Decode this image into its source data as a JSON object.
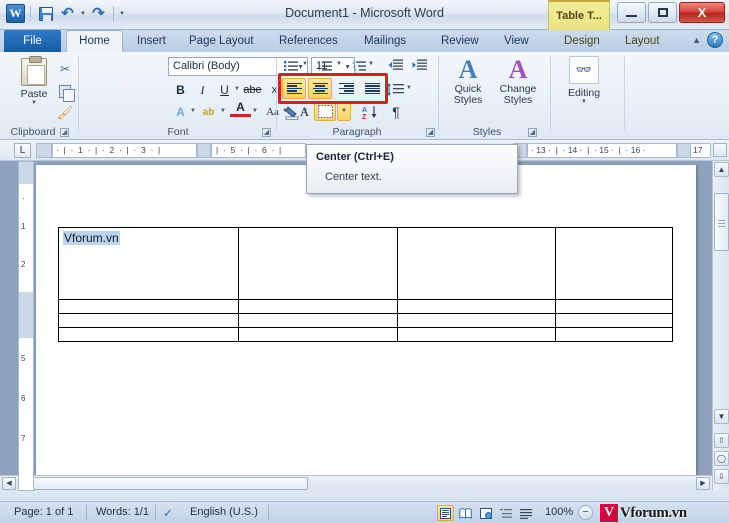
{
  "titlebar": {
    "app_icon": "word-logo-icon",
    "quick_access": [
      {
        "name": "save-icon",
        "label": "Save"
      },
      {
        "name": "undo-icon",
        "label": "Undo"
      },
      {
        "name": "redo-icon",
        "label": "Redo"
      },
      {
        "name": "customize-qat-icon",
        "label": "Customize Quick Access Toolbar"
      }
    ],
    "title": "Document1  -  Microsoft Word",
    "contextual_tab": "Table T...",
    "window_buttons": {
      "minimize": "Minimize",
      "maximize": "Maximize",
      "close": "X"
    }
  },
  "tabs": [
    {
      "label": "File",
      "state": "file"
    },
    {
      "label": "Home",
      "state": "active"
    },
    {
      "label": "Insert",
      "state": "normal"
    },
    {
      "label": "Page Layout",
      "state": "normal"
    },
    {
      "label": "References",
      "state": "normal"
    },
    {
      "label": "Mailings",
      "state": "normal"
    },
    {
      "label": "Review",
      "state": "normal"
    },
    {
      "label": "View",
      "state": "normal"
    },
    {
      "label": "Design",
      "state": "contextual"
    },
    {
      "label": "Layout",
      "state": "contextual"
    }
  ],
  "help": {
    "collapse_icon": "chevron-up-icon",
    "help_icon": "question-mark-icon",
    "help_label": "?"
  },
  "ribbon": {
    "clipboard": {
      "label": "Clipboard",
      "paste": "Paste",
      "cut": "Cut",
      "copy": "Copy",
      "format_painter": "Format Painter"
    },
    "font": {
      "label": "Font",
      "font_name": "Calibri (Body)",
      "font_size": "11",
      "bold": "B",
      "italic": "I",
      "underline": "U",
      "strikethrough": "abe",
      "subscript": "x₂",
      "superscript": "x²",
      "clear_formatting": "Clear Formatting",
      "text_effects": "A",
      "highlight": "ab",
      "font_color": "A",
      "change_case": "Aa",
      "grow_font": "A",
      "shrink_font": "A"
    },
    "paragraph": {
      "label": "Paragraph",
      "bullets": "Bullets",
      "numbering": "Numbering",
      "multilevel": "Multilevel List",
      "decrease_indent": "Decrease Indent",
      "increase_indent": "Increase Indent",
      "sort": "Sort",
      "show_marks": "¶",
      "align_left": "Align Text Left",
      "align_center": "Center",
      "align_right": "Align Text Right",
      "justify": "Justify",
      "line_spacing": "Line and Paragraph Spacing",
      "shading": "Shading",
      "borders": "Borders",
      "highlight_color": "#d91f17"
    },
    "styles": {
      "label": "Styles",
      "quick_styles_line1": "Quick",
      "quick_styles_line2": "Styles",
      "change_styles_line1": "Change",
      "change_styles_line2": "Styles"
    },
    "editing": {
      "label": "Editing",
      "button": "Editing",
      "icon": "binoculars-icon"
    }
  },
  "ruler": {
    "tab_selector": "L",
    "left_marks": [
      "1",
      "2",
      "3",
      "5",
      "6"
    ],
    "right_marks": [
      "13",
      "14",
      "15",
      "16",
      "17"
    ],
    "vertical_marks": [
      "1",
      "2",
      "5",
      "6",
      "7"
    ]
  },
  "tooltip": {
    "title": "Center (Ctrl+E)",
    "description": "Center text."
  },
  "document": {
    "table": {
      "columns": 4,
      "rows": [
        {
          "height": "tall",
          "cells": [
            "Vforum.vn",
            "",
            "",
            ""
          ],
          "selected_cell": 0
        },
        {
          "height": "short",
          "cells": [
            "",
            "",
            "",
            ""
          ]
        },
        {
          "height": "short",
          "cells": [
            "",
            "",
            "",
            ""
          ]
        },
        {
          "height": "short",
          "cells": [
            "",
            "",
            "",
            ""
          ]
        }
      ],
      "selection_color": "#b9d4f2"
    }
  },
  "statusbar": {
    "page": "Page: 1 of 1",
    "words": "Words: 1/1",
    "proofing_icon": "spell-check-icon",
    "language": "English (U.S.)",
    "view_buttons": [
      {
        "name": "print-layout-view",
        "state": "active"
      },
      {
        "name": "full-screen-reading-view",
        "state": "normal"
      },
      {
        "name": "web-layout-view",
        "state": "normal"
      },
      {
        "name": "outline-view",
        "state": "normal"
      },
      {
        "name": "draft-view",
        "state": "normal"
      }
    ],
    "zoom": "100%",
    "zoom_out": "−",
    "watermark": {
      "mark": "V",
      "text": "Vforum.vn"
    }
  }
}
